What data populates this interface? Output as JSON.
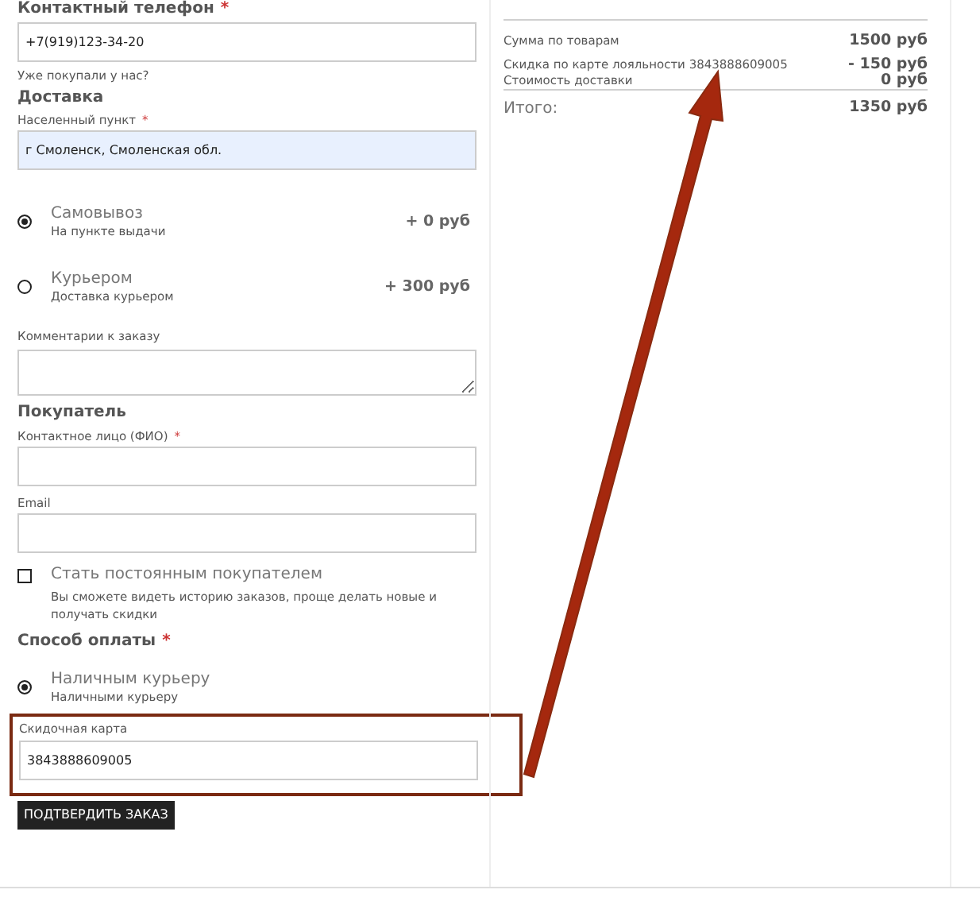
{
  "contact": {
    "heading": "Контактный телефон",
    "required_mark": "*",
    "phone": "+7(919)123-34-20",
    "returning_link": "Уже покупали у нас?"
  },
  "delivery": {
    "heading": "Доставка",
    "city_label": "Населенный пункт",
    "city_required_mark": "*",
    "city": "г Смоленск, Смоленская обл.",
    "options": [
      {
        "label": "Самовывоз",
        "note": "На пункте выдачи",
        "price": "+ 0 руб",
        "selected": true
      },
      {
        "label": "Курьером",
        "note": "Доставка курьером",
        "price": "+ 300 руб",
        "selected": false
      }
    ],
    "comment_label": "Комментарии к заказу"
  },
  "buyer": {
    "heading": "Покупатель",
    "name_label": "Контактное лицо (ФИО)",
    "name_required_mark": "*",
    "email_label": "Email",
    "regular": {
      "label": "Стать постоянным покупателем",
      "note": "Вы сможете видеть историю заказов, проще делать новые и получать скидки",
      "checked": false
    }
  },
  "payment": {
    "heading": "Способ оплаты",
    "required_mark": "*",
    "options": [
      {
        "label": "Наличным курьеру",
        "note": "Наличными курьеру",
        "selected": true
      }
    ]
  },
  "discount": {
    "label": "Скидочная карта",
    "value": "3843888609005"
  },
  "submit": "ПОДТВЕРДИТЬ ЗАКАЗ",
  "summary": {
    "rows": [
      {
        "label": "Сумма по товарам",
        "value": "1500 руб"
      },
      {
        "label": "Скидка по карте лояльности 3843888609005",
        "value": "- 150 руб"
      },
      {
        "label": "Стоимость доставки",
        "value": "0 руб"
      }
    ],
    "total_label": "Итого:",
    "total_value": "1350 руб"
  }
}
